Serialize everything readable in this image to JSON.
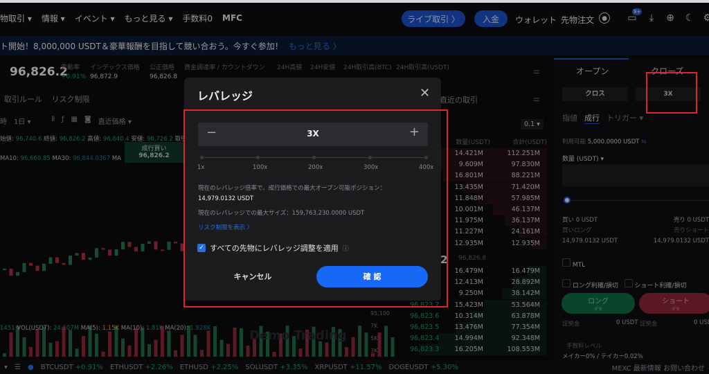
{
  "nav": {
    "items": [
      "物取引 ▾",
      "情報 ▾",
      "イベント ▾",
      "もっと見る ▾",
      "手数料0",
      "MFC"
    ],
    "live_trade": "ライブ取引 〉",
    "deposit": "入金",
    "wallet": "ウォレット",
    "futures_orders": "先物注文",
    "notif_badge": "9+"
  },
  "banner": {
    "text": "ト開始！8,000,000 USDT＆豪華報酬を目指して競い合おう。今すぐ参加！",
    "more": "もっと見る 〉"
  },
  "ticker": {
    "price": "96,826.2",
    "fields": [
      {
        "label": "変動率",
        "value": "+0.91%"
      },
      {
        "label": "インデックス価格",
        "value": "96,872.9"
      },
      {
        "label": "公正価格",
        "value": "96,826.8"
      },
      {
        "label": "資金調達率 / カウントダウン",
        "value": ""
      },
      {
        "label": "24H高値",
        "value": ""
      },
      {
        "label": "24H安値",
        "value": ""
      },
      {
        "label": "24H取引高(BTC)",
        "value": ""
      },
      {
        "label": "24H取引高(USDT)",
        "value": ""
      }
    ]
  },
  "chart": {
    "tabs": [
      "取引ルール",
      "リスク制限"
    ],
    "toolbar": {
      "timeframe_prefix": "時",
      "interval": "1日 ▾",
      "price_type": "直近価格 ▾"
    },
    "ohlc": {
      "open_label": "始値:",
      "open": "96,740.6",
      "close_label": "終値:",
      "close": "96,826.2",
      "high_label": "高値:",
      "high": "96,840.4",
      "low_label": "安値:",
      "low": "96,726.2",
      "vol_label": "取引額"
    },
    "ma": {
      "ma10_label": "MA10:",
      "ma10": "96,660.85",
      "ma30_label": "MA30:",
      "ma30": "96,844.0367",
      "ma_label": "MA"
    },
    "market_buy_tooltip": {
      "label": "成行買い",
      "price": "96,826.2"
    },
    "volume": {
      "prefix": "1451",
      "vol_label": "VOL(USDT):",
      "vol": "24.107M",
      "ma5_label": "MA(5):",
      "ma5": "1.15K",
      "ma10_label": "MA(10):",
      "ma10": "1.81K",
      "ma20_label": "MA(20):",
      "ma20": "1.828K"
    },
    "axis": [
      "95,100",
      "7K",
      "5K",
      "3K"
    ],
    "watermark": "Demo Trading"
  },
  "orderbook": {
    "title": "直近の取引",
    "precision": "0.1 ▾",
    "headers": [
      "数量(USDT)",
      "合計(USDT)"
    ],
    "asks": [
      [
        "14.421M",
        "112.251M"
      ],
      [
        "9.609M",
        "97.830M"
      ],
      [
        "16.801M",
        "88.221M"
      ],
      [
        "13.435M",
        "71.420M"
      ],
      [
        "11.848M",
        "57.985M"
      ],
      [
        "10.001M",
        "46.137M"
      ],
      [
        "11.975M",
        "36.137M"
      ],
      [
        "11.227M",
        "24.161M"
      ],
      [
        "12.935M",
        "12.935M"
      ]
    ],
    "mid": "96,826.8",
    "mid_big": "2",
    "bids": [
      [
        "",
        "16.479M",
        "16.479M"
      ],
      [
        "",
        "12.413M",
        "28.892M"
      ],
      [
        "",
        "9.250M",
        "38.142M"
      ],
      [
        "96,823.7",
        "15.423M",
        "53.564M"
      ],
      [
        "96,823.6",
        "10.314M",
        "63.878M"
      ],
      [
        "96,823.5",
        "13.476M",
        "77.354M"
      ],
      [
        "96,823.4",
        "14.994M",
        "92.348M"
      ],
      [
        "96,823.3",
        "16.205M",
        "108.553M"
      ]
    ]
  },
  "order_panel": {
    "tabs": [
      "オープン",
      "クローズ"
    ],
    "margin_mode": "クロス",
    "leverage": "3X",
    "order_types": [
      "指値",
      "成行",
      "トリガー ▾"
    ],
    "available_label": "利用可能",
    "available": "5,000.0000 USDT",
    "qty_label": "数量 (USDT) ▾",
    "buy_label": "買い 0 USDT",
    "sell_label": "売り 0 USDT",
    "long_label": "買いロング",
    "short_label": "売りショート",
    "long_max": "14,979.0132 USDT",
    "short_max": "14,979.0132 USDT",
    "mtl": "MTL",
    "long_tpsl": "ロング利確/損切",
    "short_tpsl": "ショート利確/損切",
    "long_btn": "ロング",
    "short_btn": "ショート",
    "demo_sub": "デモ",
    "margin_label": "証拠金",
    "margin_long": "0 USDT",
    "margin_short": "0 USDT",
    "fee_level": "手数料レベル",
    "fee_rates": "メイカー0% / テイカー0.02%"
  },
  "bottom_bar": {
    "items": [
      {
        "sym": "BTCUSDT",
        "chg": "+0.91%"
      },
      {
        "sym": "ETHUSDT",
        "chg": "+2.26%"
      },
      {
        "sym": "ETHUSD",
        "chg": "+2.25%"
      },
      {
        "sym": "SOLUSDT",
        "chg": "+3.35%"
      },
      {
        "sym": "XRPUSDT",
        "chg": "+11.57%"
      },
      {
        "sym": "DOGEUSDT",
        "chg": "+5.30%"
      }
    ],
    "news": "MEXC 最新情報",
    "contact": "お問い合わせ"
  },
  "modal": {
    "title": "レバレッジ",
    "value": "3X",
    "slider_value": 3,
    "slider_ticks": [
      "1x",
      "100x",
      "200x",
      "300x",
      "400x"
    ],
    "max_open_text": "現在のレバレッジ倍率で、成行価格での最大オープン可能ポジション：",
    "max_open_value": "14,979.0132 USDT",
    "max_size_text": "現在のレバレッジでの最大サイズ：159,763,230.0000 USDT",
    "risk_link": "リスク制限を表示 〉",
    "apply_all": "すべての先物にレバレッジ調整を適用",
    "apply_all_checked": true,
    "cancel": "キャンセル",
    "confirm": "確 認"
  },
  "colors": {
    "accent": "#1668f5",
    "up": "#1f9a63",
    "down": "#c4364b",
    "highlight": "#e0262b"
  }
}
